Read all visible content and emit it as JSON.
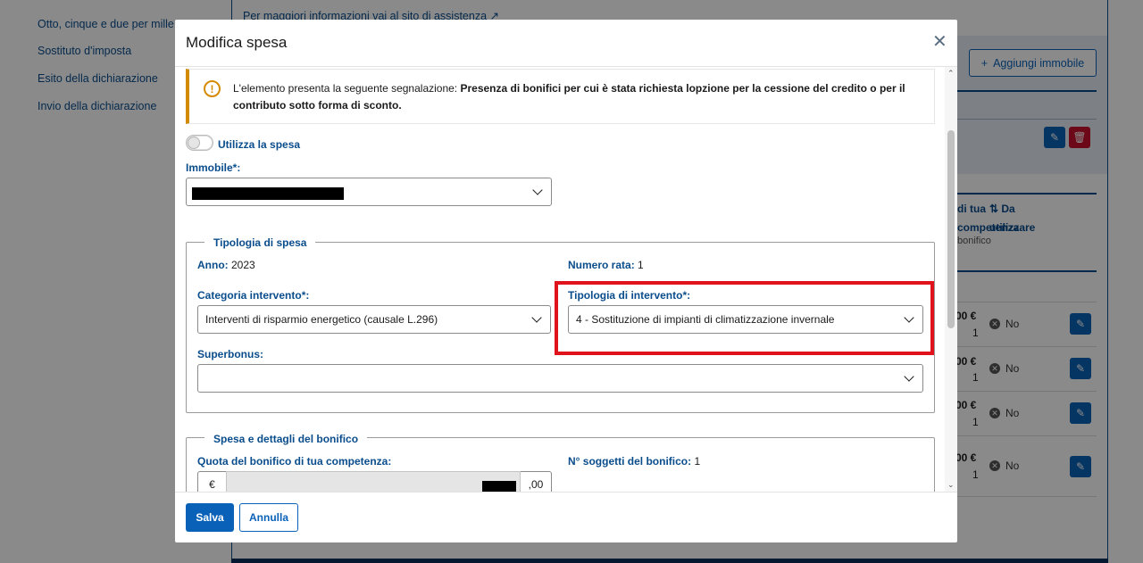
{
  "background": {
    "nav_items": [
      "Otto, cinque e due per mille",
      "Sostituto d'imposta",
      "Esito della dichiarazione",
      "Invio della dichiarazione"
    ],
    "info_text": "Per maggiori informazioni vai al sito di assistenza",
    "add_button": "Aggiungi immobile",
    "col_head_a": "di tua competenza",
    "col_head_a_sub": "bonifico",
    "col_head_b": "Da utilizzare",
    "rows": [
      {
        "amount": "00 €",
        "rata": "1",
        "status": "No"
      },
      {
        "amount": "00 €",
        "rata": "1",
        "status": "No"
      },
      {
        "amount": "00 €",
        "rata": "1",
        "status": "No"
      },
      {
        "amount": "00 €",
        "rata": "1",
        "status": "No"
      }
    ]
  },
  "modal": {
    "title": "Modifica spesa",
    "close_icon": "close-icon",
    "alert": {
      "prefix": "L'elemento presenta la seguente segnalazione: ",
      "message": "Presenza di bonifici per cui è stata richiesta lopzione per la cessione del credito o per il contributo sotto forma di sconto.",
      "color": "#d48a00"
    },
    "toggle_label": "Utilizza la spesa",
    "immobile_label": "Immobile*:",
    "tipologia_spesa": {
      "legend": "Tipologia di spesa",
      "anno_label": "Anno:",
      "anno_value": "2023",
      "numero_rata_label": "Numero rata:",
      "numero_rata_value": "1",
      "categoria_label": "Categoria intervento*:",
      "categoria_value": "Interventi di risparmio energetico (causale L.296)",
      "tipologia_label": "Tipologia di intervento*:",
      "tipologia_value": "4 - Sostituzione di impianti di climatizzazione invernale",
      "superbonus_label": "Superbonus:",
      "superbonus_value": ""
    },
    "spesa_bonifico": {
      "legend": "Spesa e dettagli del bonifico",
      "quota_label": "Quota del bonifico di tua competenza:",
      "currency": "€",
      "decimals": ",00",
      "soggetti_label": "N° soggetti del bonifico:",
      "soggetti_value": "1"
    },
    "save_label": "Salva",
    "cancel_label": "Annulla"
  },
  "colors": {
    "primary": "#0a62b8",
    "label_blue": "#0a4d8c",
    "highlight_red": "#e0121c",
    "warning": "#d48a00"
  }
}
